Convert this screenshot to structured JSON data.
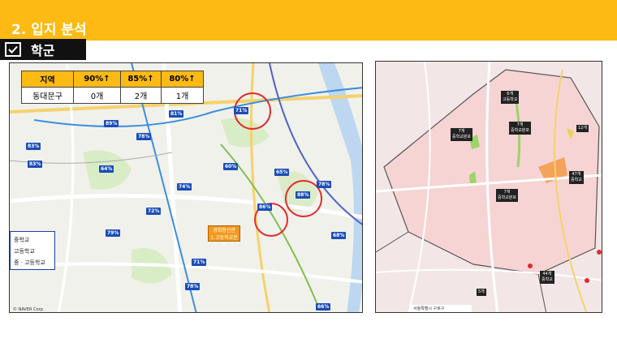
{
  "header": {
    "title": "2. 입지 분석"
  },
  "section": {
    "label": "학군"
  },
  "table": {
    "headers": [
      "지역",
      "90%↑",
      "85%↑",
      "80%↑"
    ],
    "row": [
      "동대문구",
      "0개",
      "2개",
      "1개"
    ]
  },
  "legend": {
    "items": [
      "중학교",
      "고등학교",
      "중 · 고등학교"
    ]
  },
  "left_map": {
    "badges": [
      "89%",
      "83%",
      "78%",
      "81%",
      "71%",
      "64%",
      "74%",
      "60%",
      "65%",
      "88%",
      "78%",
      "86%",
      "72%",
      "79%",
      "71%",
      "78%",
      "68%",
      "66%",
      "83%"
    ],
    "orange_label": [
      "경희정신관",
      "1 고등학교분포"
    ],
    "copyright": "© NAVER Corp."
  },
  "right_map": {
    "labels": [
      [
        "6개",
        "고등학교"
      ],
      [
        "7개",
        "중학교분포"
      ],
      [
        "7개",
        "중학교분포"
      ],
      [
        "12개"
      ],
      [
        "47개",
        "중학교"
      ],
      [
        "7개",
        "중학교분포"
      ],
      [
        "44개",
        "중학교"
      ],
      [
        "5개"
      ]
    ],
    "scale_text": "서울특별시 구로구"
  },
  "colors": {
    "accent": "#fdba12",
    "badge": "#1a4db8",
    "circle": "#e32b2b"
  }
}
